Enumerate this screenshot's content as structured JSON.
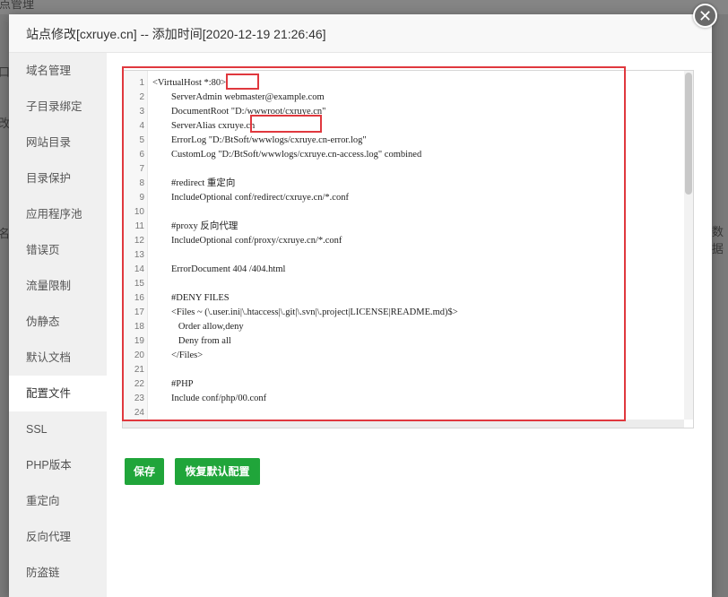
{
  "background": {
    "top_text": "站点管理",
    "left_fragment_1": "口",
    "left_fragment_2": "改",
    "left_fragment_3": "名",
    "right_fragment": "数据"
  },
  "dialog": {
    "title": "站点修改[cxruye.cn] -- 添加时间[2020-12-19 21:26:46]",
    "close_symbol": "✕"
  },
  "sidebar": {
    "items": [
      {
        "label": "域名管理"
      },
      {
        "label": "子目录绑定"
      },
      {
        "label": "网站目录"
      },
      {
        "label": "目录保护"
      },
      {
        "label": "应用程序池"
      },
      {
        "label": "错误页"
      },
      {
        "label": "流量限制"
      },
      {
        "label": "伪静态"
      },
      {
        "label": "默认文档"
      },
      {
        "label": "配置文件"
      },
      {
        "label": "SSL"
      },
      {
        "label": "PHP版本"
      },
      {
        "label": "重定向"
      },
      {
        "label": "反向代理"
      },
      {
        "label": "防盗链"
      }
    ],
    "active_index": 9
  },
  "editor": {
    "lines": [
      {
        "n": "1",
        "text": "<VirtualHost *:80>"
      },
      {
        "n": "2",
        "text": "        ServerAdmin webmaster@example.com"
      },
      {
        "n": "3",
        "text": "        DocumentRoot \"D:/wwwroot/cxruye.cn\""
      },
      {
        "n": "4",
        "text": "        ServerAlias cxruye.cn"
      },
      {
        "n": "5",
        "text": "        ErrorLog \"D:/BtSoft/wwwlogs/cxruye.cn-error.log\""
      },
      {
        "n": "6",
        "text": "        CustomLog \"D:/BtSoft/wwwlogs/cxruye.cn-access.log\" combined"
      },
      {
        "n": "7",
        "text": ""
      },
      {
        "n": "8",
        "text": "        #redirect 重定向"
      },
      {
        "n": "9",
        "text": "        IncludeOptional conf/redirect/cxruye.cn/*.conf"
      },
      {
        "n": "10",
        "text": ""
      },
      {
        "n": "11",
        "text": "        #proxy 反向代理"
      },
      {
        "n": "12",
        "text": "        IncludeOptional conf/proxy/cxruye.cn/*.conf"
      },
      {
        "n": "13",
        "text": ""
      },
      {
        "n": "14",
        "text": "        ErrorDocument 404 /404.html"
      },
      {
        "n": "15",
        "text": ""
      },
      {
        "n": "16",
        "text": "        #DENY FILES"
      },
      {
        "n": "17",
        "text": "        <Files ~ (\\.user.ini|\\.htaccess|\\.git|\\.svn|\\.project|LICENSE|README.md)$>"
      },
      {
        "n": "18",
        "text": "           Order allow,deny"
      },
      {
        "n": "19",
        "text": "           Deny from all"
      },
      {
        "n": "20",
        "text": "        </Files>"
      },
      {
        "n": "21",
        "text": ""
      },
      {
        "n": "22",
        "text": "        #PHP"
      },
      {
        "n": "23",
        "text": "        Include conf/php/00.conf"
      },
      {
        "n": "24",
        "text": ""
      }
    ]
  },
  "buttons": {
    "save": "保存",
    "restore_default": "恢复默认配置"
  },
  "colors": {
    "accent_green": "#20a53a",
    "highlight_red": "#e0383e"
  }
}
